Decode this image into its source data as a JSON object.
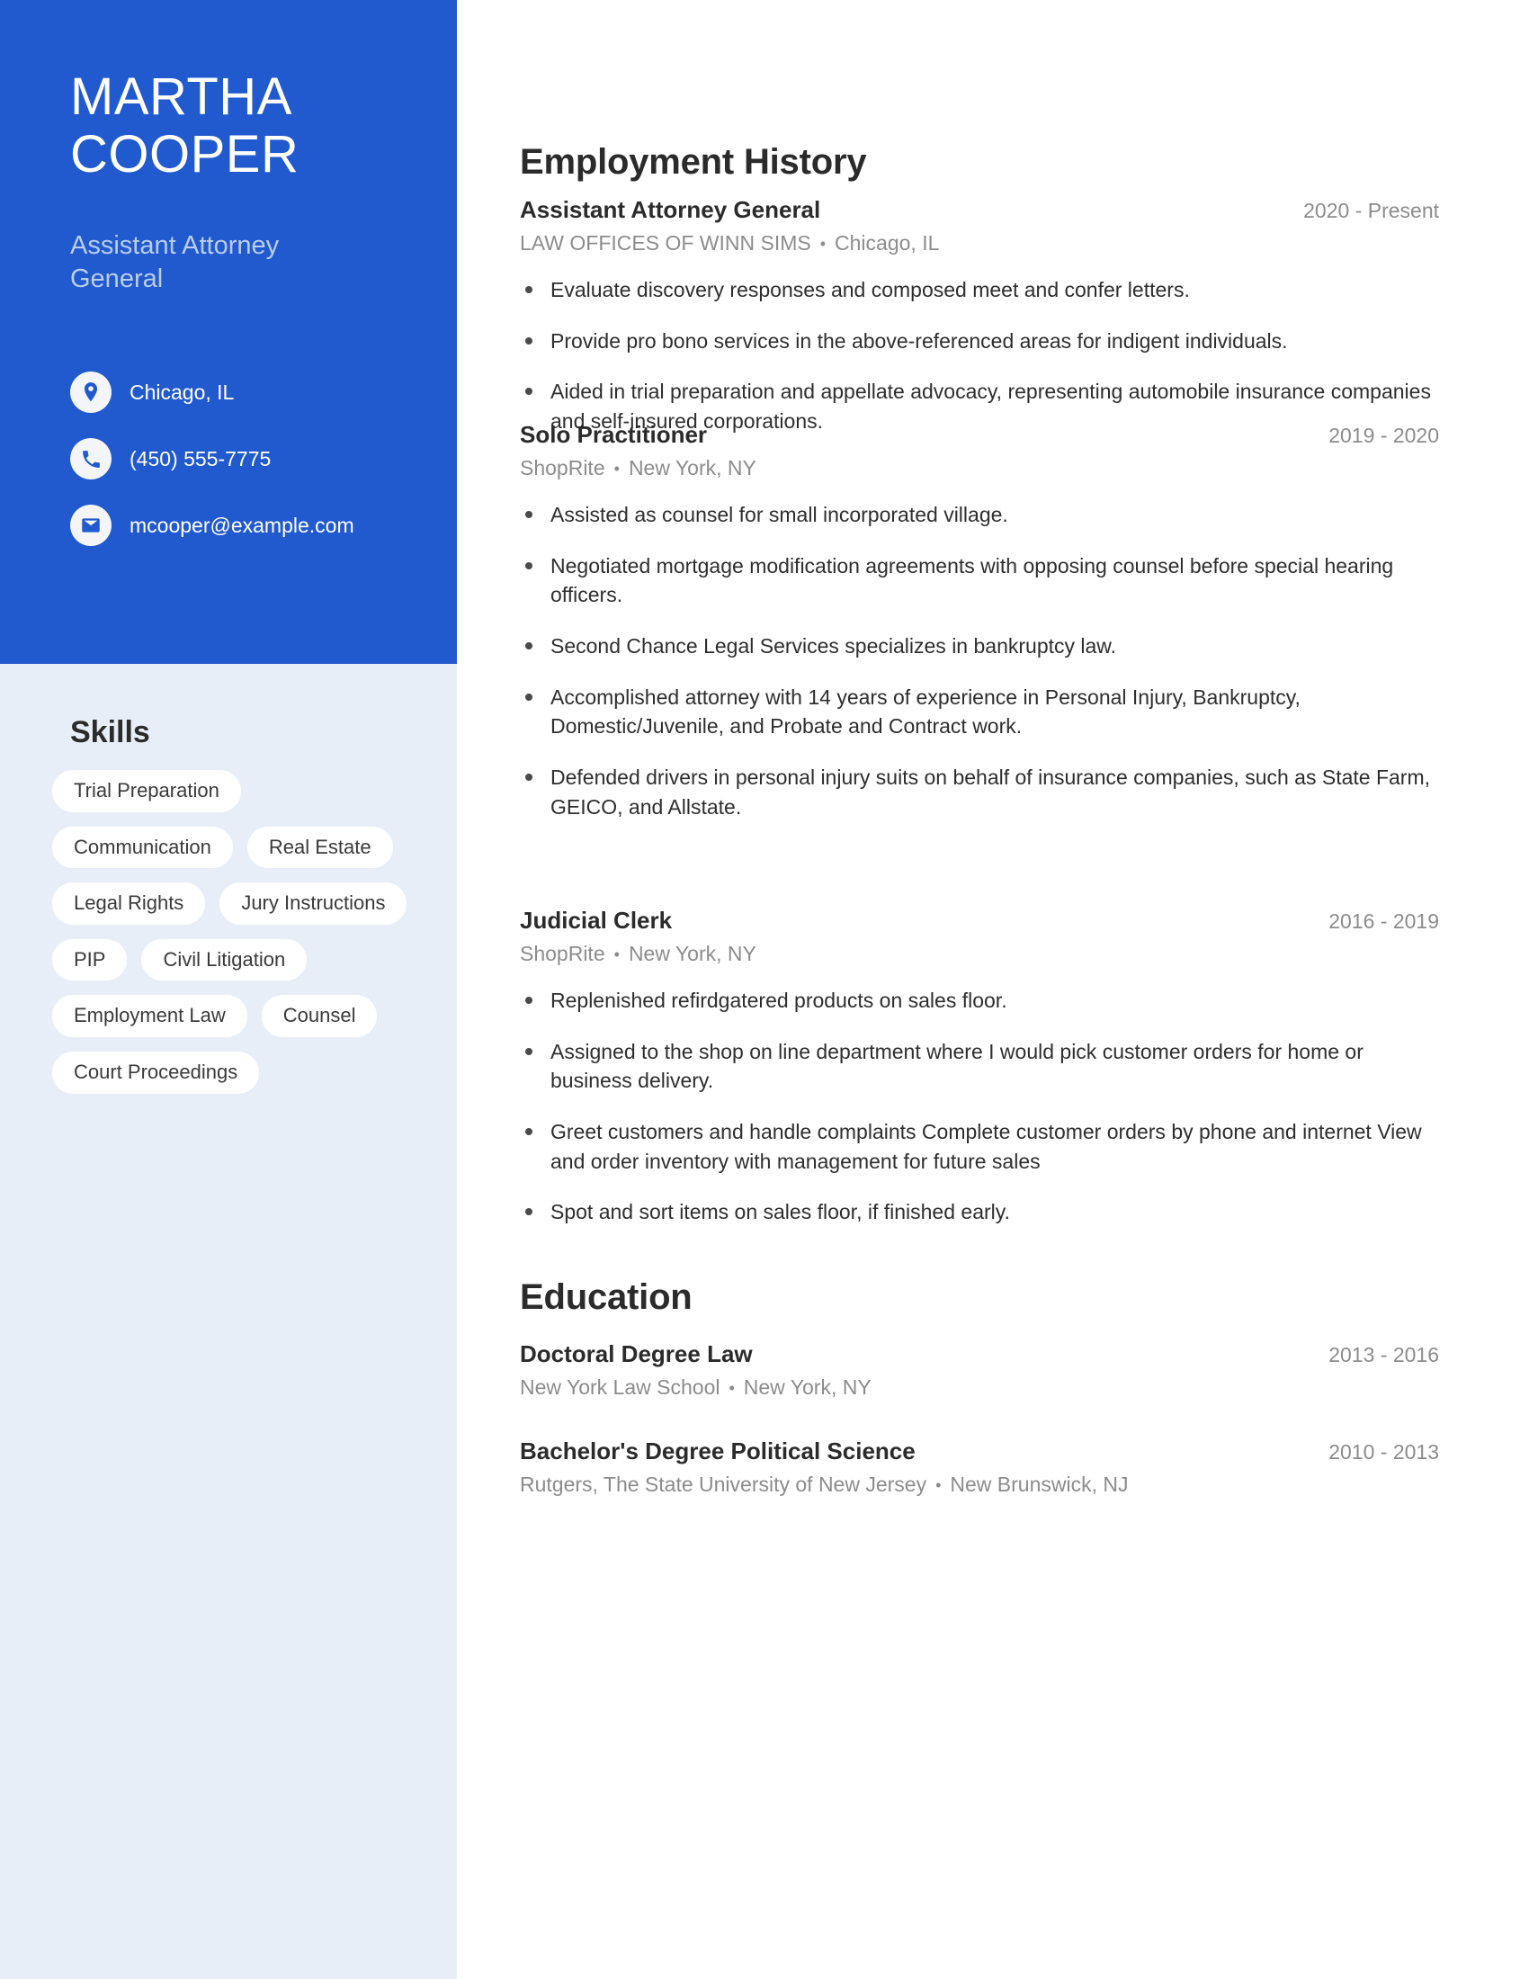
{
  "colors": {
    "header_blue": "#2159CE",
    "sidebar_blue": "#E8EEF8",
    "pill_white": "#FFFFFF",
    "muted_gray": "#8C8C8C",
    "body_text": "#2E2E2E",
    "subtitle_blue": "#B9CDF0"
  },
  "sidebar": {
    "name": "Martha Cooper",
    "job_title": "Assistant Attorney General",
    "contacts": [
      {
        "icon": "location-pin-icon",
        "value": "Chicago, IL"
      },
      {
        "icon": "phone-icon",
        "value": "(450) 555-7775"
      },
      {
        "icon": "email-icon",
        "value": "mcooper@example.com"
      }
    ],
    "skills_heading": "Skills",
    "skills": [
      "Trial Preparation",
      "Communication",
      "Real Estate",
      "Legal Rights",
      "Jury Instructions",
      "PIP",
      "Civil Litigation",
      "Employment Law",
      "Counsel",
      "Court Proceedings"
    ]
  },
  "main": {
    "employment_heading": "Employment History",
    "education_heading": "Education",
    "separator": "•",
    "jobs": [
      {
        "title": "Assistant Attorney General",
        "dates": "2020 - Present",
        "company": "LAW OFFICES OF WINN SIMS",
        "location": "Chicago, IL",
        "bullets": [
          "Evaluate discovery responses and composed meet and confer letters.",
          "Provide pro bono services in the above-referenced areas for indigent individuals.",
          "Aided in trial preparation and appellate advocacy, representing automobile insurance companies and self-insured corporations."
        ]
      },
      {
        "title": "Solo Practitioner",
        "dates": "2019 - 2020",
        "company": "ShopRite",
        "location": "New York, NY",
        "bullets": [
          "Assisted as counsel for small incorporated village.",
          "Negotiated mortgage modification agreements with opposing counsel before special hearing officers.",
          "Second Chance Legal Services specializes in bankruptcy law.",
          "Accomplished attorney with 14 years of experience in Personal Injury, Bankruptcy, Domestic/Juvenile, and Probate and Contract work.",
          "Defended drivers in personal injury suits on behalf of insurance companies, such as State Farm, GEICO, and Allstate."
        ]
      },
      {
        "title": "Judicial Clerk",
        "dates": "2016 - 2019",
        "company": "ShopRite",
        "location": "New York, NY",
        "bullets": [
          "Replenished refirdgatered products on sales floor.",
          "Assigned to the shop on line department where I would pick customer orders for home or business delivery.",
          "Greet customers and handle complaints Complete customer orders by phone and internet View and order inventory with management for future sales",
          "Spot and sort items on sales floor, if finished early."
        ]
      }
    ],
    "education": [
      {
        "degree": "Doctoral Degree Law",
        "dates": "2013 - 2016",
        "school": "New York Law School",
        "location": "New York, NY"
      },
      {
        "degree": "Bachelor's Degree Political Science",
        "dates": "2010 - 2013",
        "school": "Rutgers, The State University of New Jersey",
        "location": "New Brunswick, NJ"
      }
    ]
  }
}
